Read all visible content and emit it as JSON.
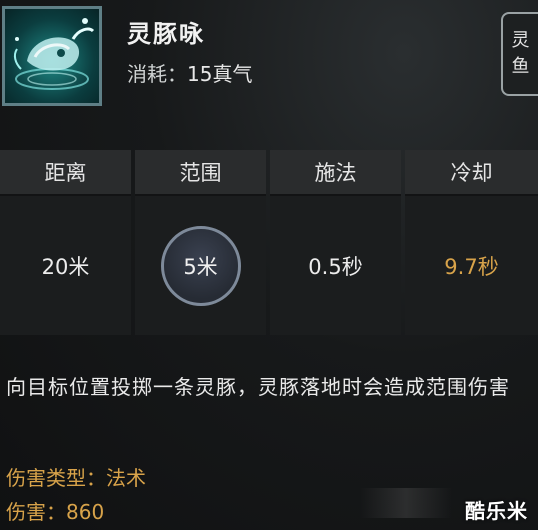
{
  "skill": {
    "name": "灵豚咏",
    "cost_label": "消耗：",
    "cost_value": "15真气",
    "tag": [
      "灵",
      "鱼"
    ]
  },
  "stats": [
    {
      "label": "距离",
      "value": "20米"
    },
    {
      "label": "范围",
      "value": "5米"
    },
    {
      "label": "施法",
      "value": "0.5秒"
    },
    {
      "label": "冷却",
      "value": "9.7秒"
    }
  ],
  "description": "向目标位置投掷一条灵豚，灵豚落地时会造成范围伤害",
  "damage": {
    "type_label": "伤害类型：",
    "type_value": "法术",
    "amount_label": "伤害：",
    "amount_value": "860"
  },
  "watermark": "酷乐米",
  "colors": {
    "accent_gold": "#d8a34a",
    "icon_teal": "#1f8a86"
  }
}
